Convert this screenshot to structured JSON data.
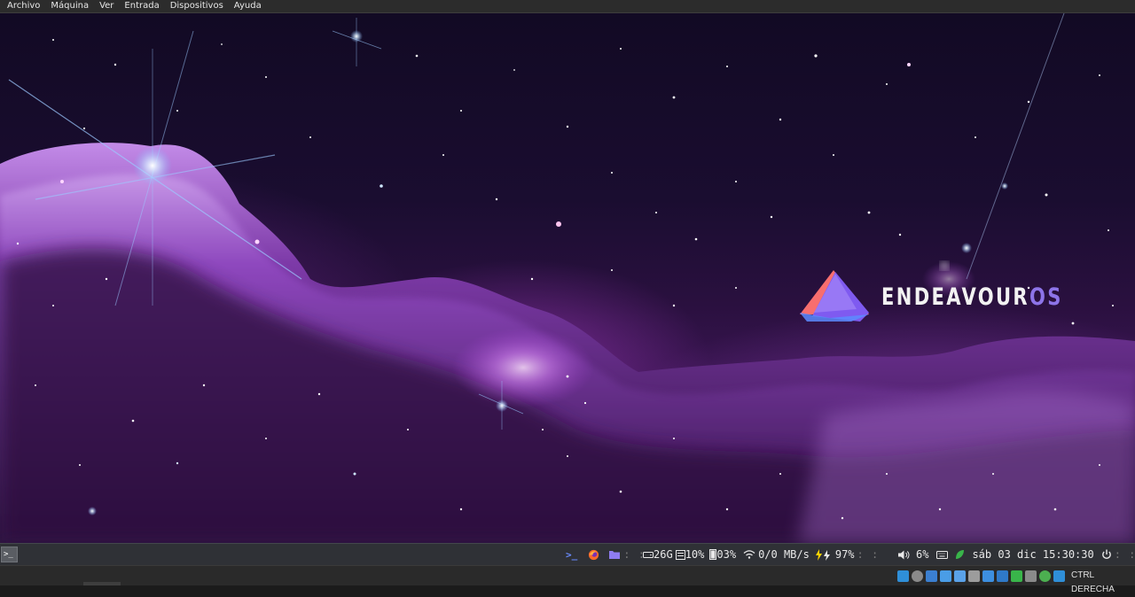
{
  "menubar": {
    "items": [
      "Archivo",
      "Máquina",
      "Ver",
      "Entrada",
      "Dispositivos",
      "Ayuda"
    ]
  },
  "desktop": {
    "logo": {
      "name_main": "ENDEAVOUR",
      "name_os": "OS",
      "icon": "endeavouros-logo-icon"
    },
    "background": "carina-nebula-wallpaper"
  },
  "panel": {
    "terminal_button": {
      "icon": "terminal-icon",
      "label": ">_"
    },
    "launchers": [
      {
        "icon": "terminal-icon"
      },
      {
        "icon": "firefox-icon"
      },
      {
        "icon": "folder-icon"
      }
    ],
    "disk": {
      "icon": "hard-drive-icon",
      "value": "26G"
    },
    "cpu": {
      "icon": "cpu-icon",
      "value": "10%"
    },
    "memory": {
      "icon": "memory-icon",
      "value": "03%"
    },
    "network": {
      "icon": "wifi-icon",
      "value": "0/0 MB/s"
    },
    "battery": {
      "icon": "battery-charging-icon",
      "value": "97%"
    },
    "volume": {
      "icon": "speaker-icon",
      "value": "6%"
    },
    "keyboard": {
      "icon": "keyboard-icon"
    },
    "updates": {
      "icon": "leaf-icon"
    },
    "clock": "sáb 03 dic 15:30:30",
    "power": {
      "icon": "power-icon"
    },
    "switch": {
      "icon": "switch-icon"
    }
  },
  "statusbar": {
    "host_key": "CTRL DERECHA",
    "icons": [
      "hard-disk-icon",
      "optical-disk-icon",
      "audio-icon",
      "network-icon",
      "usb-icon",
      "shared-folder-icon",
      "display-icon",
      "capture-icon",
      "mouse-integration-icon",
      "host-key-icon",
      "cpu-activity-icon",
      "download-icon"
    ],
    "colors": {
      "accent_blue": "#2f8fd8",
      "accent_green": "#39b54a",
      "logo_purple": "#7f5af0",
      "logo_coral": "#f86e6e"
    }
  }
}
